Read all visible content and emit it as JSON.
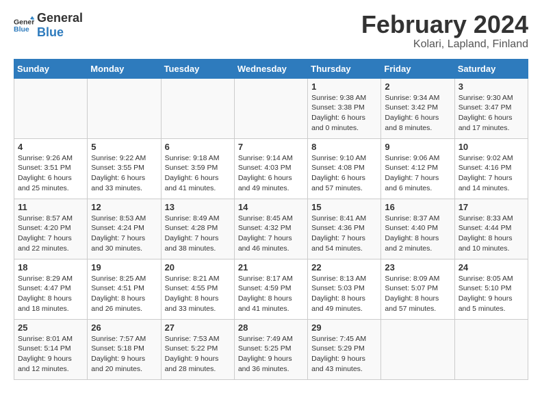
{
  "logo": {
    "text_general": "General",
    "text_blue": "Blue"
  },
  "title": "February 2024",
  "subtitle": "Kolari, Lapland, Finland",
  "headers": [
    "Sunday",
    "Monday",
    "Tuesday",
    "Wednesday",
    "Thursday",
    "Friday",
    "Saturday"
  ],
  "weeks": [
    [
      {
        "day": "",
        "info": ""
      },
      {
        "day": "",
        "info": ""
      },
      {
        "day": "",
        "info": ""
      },
      {
        "day": "",
        "info": ""
      },
      {
        "day": "1",
        "info": "Sunrise: 9:38 AM\nSunset: 3:38 PM\nDaylight: 6 hours\nand 0 minutes."
      },
      {
        "day": "2",
        "info": "Sunrise: 9:34 AM\nSunset: 3:42 PM\nDaylight: 6 hours\nand 8 minutes."
      },
      {
        "day": "3",
        "info": "Sunrise: 9:30 AM\nSunset: 3:47 PM\nDaylight: 6 hours\nand 17 minutes."
      }
    ],
    [
      {
        "day": "4",
        "info": "Sunrise: 9:26 AM\nSunset: 3:51 PM\nDaylight: 6 hours\nand 25 minutes."
      },
      {
        "day": "5",
        "info": "Sunrise: 9:22 AM\nSunset: 3:55 PM\nDaylight: 6 hours\nand 33 minutes."
      },
      {
        "day": "6",
        "info": "Sunrise: 9:18 AM\nSunset: 3:59 PM\nDaylight: 6 hours\nand 41 minutes."
      },
      {
        "day": "7",
        "info": "Sunrise: 9:14 AM\nSunset: 4:03 PM\nDaylight: 6 hours\nand 49 minutes."
      },
      {
        "day": "8",
        "info": "Sunrise: 9:10 AM\nSunset: 4:08 PM\nDaylight: 6 hours\nand 57 minutes."
      },
      {
        "day": "9",
        "info": "Sunrise: 9:06 AM\nSunset: 4:12 PM\nDaylight: 7 hours\nand 6 minutes."
      },
      {
        "day": "10",
        "info": "Sunrise: 9:02 AM\nSunset: 4:16 PM\nDaylight: 7 hours\nand 14 minutes."
      }
    ],
    [
      {
        "day": "11",
        "info": "Sunrise: 8:57 AM\nSunset: 4:20 PM\nDaylight: 7 hours\nand 22 minutes."
      },
      {
        "day": "12",
        "info": "Sunrise: 8:53 AM\nSunset: 4:24 PM\nDaylight: 7 hours\nand 30 minutes."
      },
      {
        "day": "13",
        "info": "Sunrise: 8:49 AM\nSunset: 4:28 PM\nDaylight: 7 hours\nand 38 minutes."
      },
      {
        "day": "14",
        "info": "Sunrise: 8:45 AM\nSunset: 4:32 PM\nDaylight: 7 hours\nand 46 minutes."
      },
      {
        "day": "15",
        "info": "Sunrise: 8:41 AM\nSunset: 4:36 PM\nDaylight: 7 hours\nand 54 minutes."
      },
      {
        "day": "16",
        "info": "Sunrise: 8:37 AM\nSunset: 4:40 PM\nDaylight: 8 hours\nand 2 minutes."
      },
      {
        "day": "17",
        "info": "Sunrise: 8:33 AM\nSunset: 4:44 PM\nDaylight: 8 hours\nand 10 minutes."
      }
    ],
    [
      {
        "day": "18",
        "info": "Sunrise: 8:29 AM\nSunset: 4:47 PM\nDaylight: 8 hours\nand 18 minutes."
      },
      {
        "day": "19",
        "info": "Sunrise: 8:25 AM\nSunset: 4:51 PM\nDaylight: 8 hours\nand 26 minutes."
      },
      {
        "day": "20",
        "info": "Sunrise: 8:21 AM\nSunset: 4:55 PM\nDaylight: 8 hours\nand 33 minutes."
      },
      {
        "day": "21",
        "info": "Sunrise: 8:17 AM\nSunset: 4:59 PM\nDaylight: 8 hours\nand 41 minutes."
      },
      {
        "day": "22",
        "info": "Sunrise: 8:13 AM\nSunset: 5:03 PM\nDaylight: 8 hours\nand 49 minutes."
      },
      {
        "day": "23",
        "info": "Sunrise: 8:09 AM\nSunset: 5:07 PM\nDaylight: 8 hours\nand 57 minutes."
      },
      {
        "day": "24",
        "info": "Sunrise: 8:05 AM\nSunset: 5:10 PM\nDaylight: 9 hours\nand 5 minutes."
      }
    ],
    [
      {
        "day": "25",
        "info": "Sunrise: 8:01 AM\nSunset: 5:14 PM\nDaylight: 9 hours\nand 12 minutes."
      },
      {
        "day": "26",
        "info": "Sunrise: 7:57 AM\nSunset: 5:18 PM\nDaylight: 9 hours\nand 20 minutes."
      },
      {
        "day": "27",
        "info": "Sunrise: 7:53 AM\nSunset: 5:22 PM\nDaylight: 9 hours\nand 28 minutes."
      },
      {
        "day": "28",
        "info": "Sunrise: 7:49 AM\nSunset: 5:25 PM\nDaylight: 9 hours\nand 36 minutes."
      },
      {
        "day": "29",
        "info": "Sunrise: 7:45 AM\nSunset: 5:29 PM\nDaylight: 9 hours\nand 43 minutes."
      },
      {
        "day": "",
        "info": ""
      },
      {
        "day": "",
        "info": ""
      }
    ]
  ]
}
